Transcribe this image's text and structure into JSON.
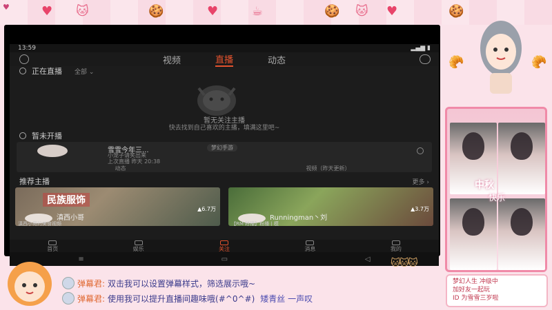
{
  "status_bar": {
    "time": "13:59",
    "signal": "▂▄▆ ▮"
  },
  "top_nav": {
    "tabs": [
      {
        "label": "视频",
        "active": false
      },
      {
        "label": "直播",
        "active": true
      },
      {
        "label": "动态",
        "active": false
      }
    ]
  },
  "live_now": {
    "title": "正在直播",
    "filter": "全部 ⌄",
    "empty_title": "暂无关注主播",
    "empty_sub": "快去找到自己喜欢的主播，填满这里吧~"
  },
  "offline": {
    "title": "暂未开播",
    "card": {
      "name": "雪雪今年三...",
      "game": "梦幻手游",
      "desc": "小笼子请笑出来",
      "time": "上次直播 昨天 20:38",
      "tabs": [
        "动态",
        "视频（昨天更新）"
      ]
    }
  },
  "recommend": {
    "title": "推荐主播",
    "more": "更多 ›",
    "cards": [
      {
        "banner": "民族服饰",
        "viewers": "▲6.7万",
        "name": "滇西小哥",
        "sub": "滇西小哥的美食视频"
      },
      {
        "banner": "",
        "viewers": "▲3.7万",
        "name": "Runningman丶刘",
        "sub": "【RM·粉播】粉播 | 模"
      }
    ]
  },
  "tab_bar": {
    "items": [
      {
        "label": "首页",
        "active": false
      },
      {
        "label": "娱乐",
        "active": false
      },
      {
        "label": "关注",
        "active": true
      },
      {
        "label": "消息",
        "active": false
      },
      {
        "label": "我的",
        "active": false
      }
    ]
  },
  "sys_nav": [
    "≡",
    "▭",
    "◁"
  ],
  "streamer_panel": {
    "caption_1": "中秋",
    "caption_2": "快乐"
  },
  "info_note": {
    "line1": "梦幻人生 冲级中",
    "line2": "加好友一起玩",
    "line3": "ID 为雪雪三岁啦"
  },
  "danmaku": [
    {
      "name": "弹幕君:",
      "text": "双击我可以设置弹幕样式，筛选展示哦~",
      "extra": ""
    },
    {
      "name": "弹幕君:",
      "text": "使用我可以提升直播间趣味哦(#^0^#)",
      "extra": "矮青丝 一声叹"
    }
  ],
  "colors": {
    "accent": "#e5532e",
    "frame_pink": "#fbe3ea",
    "danmaku_name": "#e06a34",
    "danmaku_text": "#3b3b8c"
  }
}
